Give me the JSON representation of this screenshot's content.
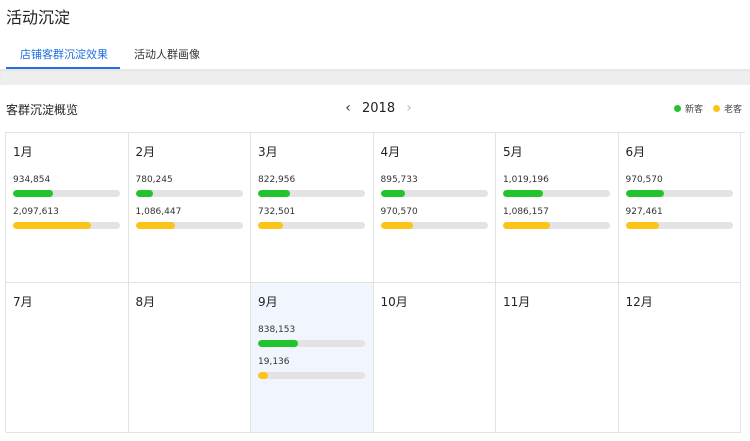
{
  "page": {
    "title": "活动沉淀"
  },
  "tabs": [
    {
      "label": "店铺客群沉淀效果",
      "active": true
    },
    {
      "label": "活动人群画像",
      "active": false
    }
  ],
  "overview": {
    "title": "客群沉淀概览",
    "year": "2018",
    "prev_icon": "chevron-left-icon",
    "next_icon": "chevron-right-icon",
    "legend": [
      {
        "label": "新客",
        "color": "#22c42d"
      },
      {
        "label": "老客",
        "color": "#fcc419"
      }
    ],
    "selected_month": "9月"
  },
  "chart_data": {
    "type": "bar",
    "title": "客群沉淀概览",
    "year": "2018",
    "categories": [
      "1月",
      "2月",
      "3月",
      "4月",
      "5月",
      "6月",
      "7月",
      "8月",
      "9月",
      "10月",
      "11月",
      "12月"
    ],
    "series": [
      {
        "name": "新客",
        "color": "#22c42d",
        "values": [
          934854,
          780245,
          822956,
          895733,
          1019196,
          970570,
          null,
          null,
          838153,
          null,
          null,
          null
        ],
        "labels": [
          "934,854",
          "780,245",
          "822,956",
          "895,733",
          "1,019,196",
          "970,570",
          "",
          "",
          "838,153",
          "",
          "",
          ""
        ],
        "fill_ratio": [
          0.37,
          0.16,
          0.3,
          0.23,
          0.37,
          0.36,
          null,
          null,
          0.37,
          null,
          null,
          null
        ]
      },
      {
        "name": "老客",
        "color": "#fcc419",
        "values": [
          2097613,
          1086447,
          732501,
          970570,
          1086157,
          927461,
          null,
          null,
          19136,
          null,
          null,
          null
        ],
        "labels": [
          "2,097,613",
          "1,086,447",
          "732,501",
          "970,570",
          "1,086,157",
          "927,461",
          "",
          "",
          "19,136",
          "",
          "",
          ""
        ],
        "fill_ratio": [
          0.73,
          0.37,
          0.23,
          0.3,
          0.44,
          0.31,
          null,
          null,
          0.09,
          null,
          null,
          null
        ]
      }
    ]
  }
}
